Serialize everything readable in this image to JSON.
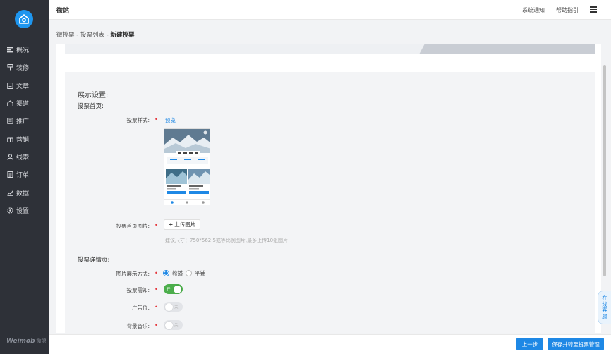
{
  "sidebar": {
    "brand": "Weimob",
    "brand_cn": "微盟",
    "items": [
      {
        "label": "概况",
        "icon": "overview-icon"
      },
      {
        "label": "装修",
        "icon": "paint-icon"
      },
      {
        "label": "文章",
        "icon": "article-icon"
      },
      {
        "label": "渠道",
        "icon": "channel-icon"
      },
      {
        "label": "推广",
        "icon": "promote-icon"
      },
      {
        "label": "营销",
        "icon": "marketing-icon"
      },
      {
        "label": "线索",
        "icon": "leads-icon"
      },
      {
        "label": "订单",
        "icon": "order-icon"
      },
      {
        "label": "数据",
        "icon": "data-icon"
      },
      {
        "label": "设置",
        "icon": "gear-icon"
      }
    ]
  },
  "header": {
    "title": "微站",
    "notify": "系统通知",
    "help": "帮助指引"
  },
  "breadcrumb": {
    "part1": "微投票",
    "sep": " - ",
    "part2": "投票列表",
    "current": "新建投票"
  },
  "form": {
    "display_title": "展示设置:",
    "home_title": "投票首页:",
    "vote_style_label": "投票样式:",
    "preview": "预览",
    "home_image_label": "投票首页图片:",
    "upload_label": "上传图片",
    "upload_hint": "建议尺寸：750*562.5或等比例图片,最多上传10张图片",
    "detail_title": "投票详情页:",
    "image_mode_label": "图片展示方式:",
    "image_mode_options": [
      "轮播",
      "平铺"
    ],
    "image_mode_selected": "轮播",
    "notice_label": "投票需知:",
    "notice_on": "开",
    "ad_label": "广告位:",
    "ad_off": "关",
    "music_label": "背景音乐:",
    "music_off": "关",
    "required_mark": "•"
  },
  "service": {
    "label": [
      "在",
      "线",
      "客",
      "服"
    ]
  },
  "footer": {
    "prev": "上一步",
    "save": "保存并转至投票管理"
  },
  "colors": {
    "sidebar": "#2e3138",
    "primary": "#1e88e5",
    "toggle_on": "#4cae4c",
    "required": "#e5353b"
  }
}
